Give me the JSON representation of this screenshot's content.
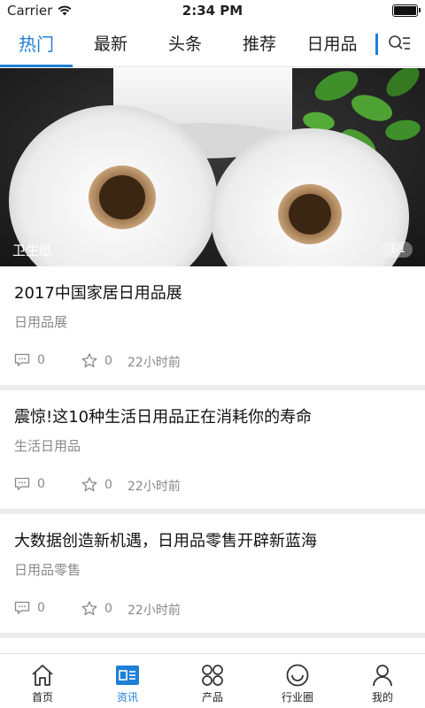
{
  "status_bar": {
    "carrier": "Carrier",
    "time": "2:34 PM"
  },
  "tabs": [
    {
      "label": "热门",
      "active": true
    },
    {
      "label": "最新",
      "active": false
    },
    {
      "label": "头条",
      "active": false
    },
    {
      "label": "推荐",
      "active": false
    },
    {
      "label": "日用品",
      "active": false
    }
  ],
  "banner": {
    "caption": "卫生纸",
    "page_indicator": "1/1"
  },
  "articles": [
    {
      "title": "2017中国家居日用品展",
      "tag": "日用品展",
      "comments": "0",
      "favorites": "0",
      "time": "22小时前"
    },
    {
      "title": "震惊!这10种生活日用品正在消耗你的寿命",
      "tag": "生活日用品",
      "comments": "0",
      "favorites": "0",
      "time": "22小时前"
    },
    {
      "title": "大数据创造新机遇，日用品零售开辟新蓝海",
      "tag": "日用品零售",
      "comments": "0",
      "favorites": "0",
      "time": "22小时前"
    }
  ],
  "bottom_nav": [
    {
      "label": "首页",
      "icon": "home-icon",
      "active": false
    },
    {
      "label": "资讯",
      "icon": "news-icon",
      "active": true
    },
    {
      "label": "产品",
      "icon": "products-icon",
      "active": false
    },
    {
      "label": "行业圈",
      "icon": "circle-icon",
      "active": false
    },
    {
      "label": "我的",
      "icon": "profile-icon",
      "active": false
    }
  ],
  "colors": {
    "accent": "#1f7fd6",
    "separator": "#ececec",
    "secondary_text": "#8a8a8a"
  }
}
